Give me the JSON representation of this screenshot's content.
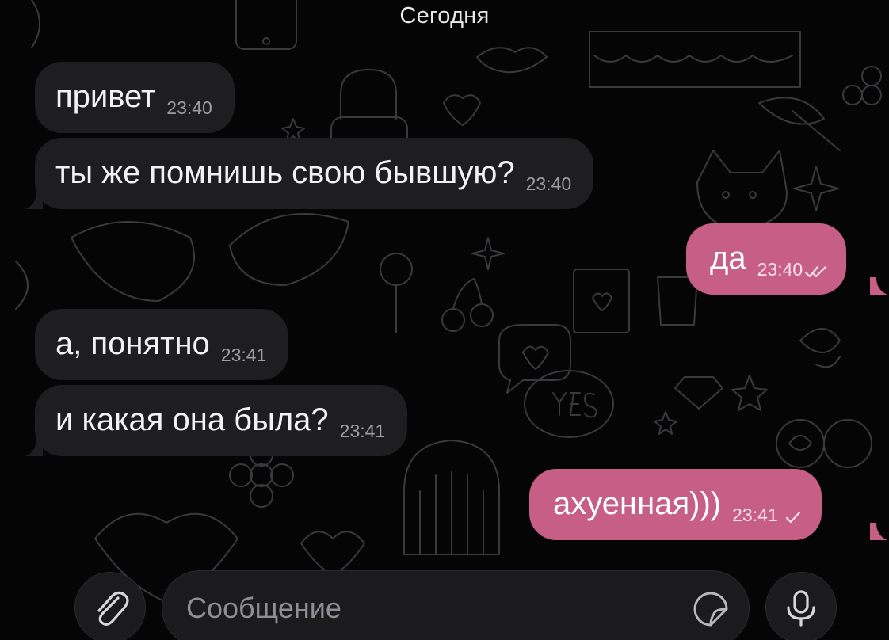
{
  "chat": {
    "date_separator": "Сегодня",
    "messages": [
      {
        "direction": "incoming",
        "text": "привет",
        "time": "23:40"
      },
      {
        "direction": "incoming",
        "text": "ты же помнишь свою бывшую?",
        "time": "23:40"
      },
      {
        "direction": "outgoing",
        "text": "да",
        "time": "23:40",
        "status": "read"
      },
      {
        "direction": "incoming",
        "text": "а, понятно",
        "time": "23:41"
      },
      {
        "direction": "incoming",
        "text": "и какая она была?",
        "time": "23:41"
      },
      {
        "direction": "outgoing",
        "text": "ахуенная)))",
        "time": "23:41",
        "status": "sent"
      }
    ]
  },
  "composer": {
    "placeholder": "Сообщение",
    "value": "",
    "attach_icon": "paperclip-icon",
    "sticker_icon": "sticker-icon",
    "mic_icon": "microphone-icon"
  },
  "colors": {
    "background": "#050505",
    "incoming_bubble": "#1e1e21",
    "outgoing_bubble": "#c65e86",
    "doodle_stroke": "#3a3a3e"
  }
}
